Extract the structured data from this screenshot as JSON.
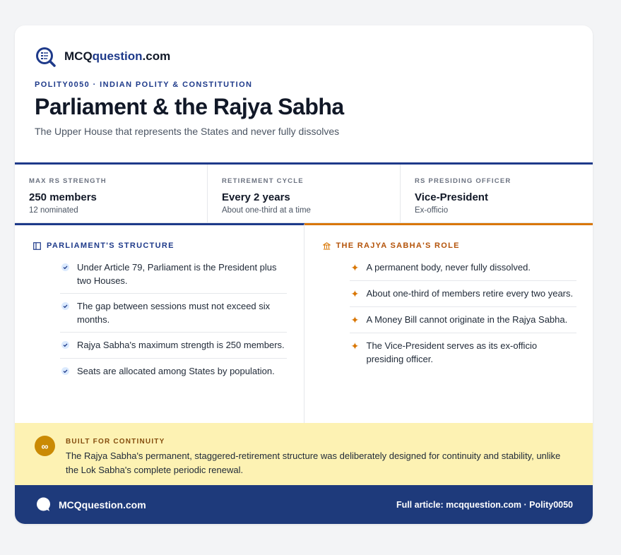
{
  "brand": {
    "name_prefix": "MCQ",
    "name_highlight": "question",
    "name_suffix": ".com"
  },
  "eyebrow": "POLITY0050 · INDIAN POLITY & CONSTITUTION",
  "title": "Parliament & the Rajya Sabha",
  "subtitle": "The Upper House that represents the States and never fully dissolves",
  "stats": [
    {
      "label": "MAX RS STRENGTH",
      "value": "250 members",
      "note": "12 nominated"
    },
    {
      "label": "RETIREMENT CYCLE",
      "value": "Every 2 years",
      "note": "About one-third at a time"
    },
    {
      "label": "RS PRESIDING OFFICER",
      "value": "Vice-President",
      "note": "Ex-officio"
    }
  ],
  "left": {
    "title": "PARLIAMENT'S STRUCTURE",
    "items": [
      "Under Article 79, Parliament is the President plus two Houses.",
      "The gap between sessions must not exceed six months.",
      "Rajya Sabha's maximum strength is 250 members.",
      "Seats are allocated among States by population."
    ]
  },
  "right": {
    "title": "THE RAJYA SABHA'S ROLE",
    "items": [
      "A permanent body, never fully dissolved.",
      "About one-third of members retire every two years.",
      "A Money Bill cannot originate in the Rajya Sabha.",
      "The Vice-President serves as its ex-officio presiding officer."
    ]
  },
  "callout": {
    "title": "BUILT FOR CONTINUITY",
    "text": "The Rajya Sabha's permanent, staggered-retirement structure was deliberately designed for continuity and stability, unlike the Lok Sabha's complete periodic renewal.",
    "icon_glyph": "∞"
  },
  "footer": {
    "brand": "MCQquestion.com",
    "link": "Full article: mcqquestion.com · Polity0050"
  },
  "colors": {
    "navy": "#1e3a8a",
    "amber": "#d97706",
    "callout_bg": "#fdf2b3"
  },
  "icons": {
    "logo": "quiz-magnifier-icon",
    "left": "book-icon",
    "right": "building-icon",
    "left_bullet": "check-icon",
    "right_bullet": "sparkle-icon",
    "callout": "infinity-icon"
  }
}
